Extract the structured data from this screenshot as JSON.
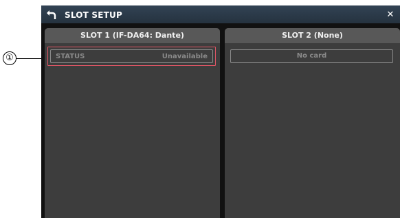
{
  "window": {
    "title": "SLOT SETUP",
    "back_icon": "back-arrow-icon",
    "close_icon": "close-icon",
    "close_glyph": "✕"
  },
  "callout": {
    "number": "①"
  },
  "slots": [
    {
      "header": "SLOT 1 (IF-DA64: Dante)",
      "status_label": "STATUS",
      "status_value": "Unavailable"
    },
    {
      "header": "SLOT 2 (None)",
      "status_text": "No card"
    }
  ],
  "colors": {
    "titlebar": "#2b3846",
    "panel_bg": "#3d3d3d",
    "panel_header": "#585858",
    "highlight": "#e05565"
  }
}
